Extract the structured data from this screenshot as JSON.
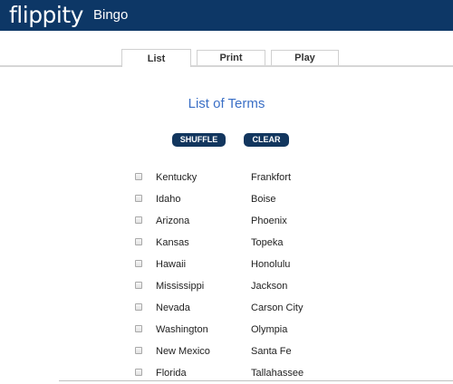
{
  "header": {
    "logo": "flippity",
    "app_title": "Bingo"
  },
  "tabs": [
    {
      "label": "List",
      "active": true
    },
    {
      "label": "Print",
      "active": false
    },
    {
      "label": "Play",
      "active": false
    }
  ],
  "main": {
    "heading": "List of Terms",
    "shuffle_label": "SHUFFLE",
    "clear_label": "CLEAR"
  },
  "terms": [
    {
      "term": "Kentucky",
      "definition": "Frankfort",
      "checked": false
    },
    {
      "term": "Idaho",
      "definition": "Boise",
      "checked": false
    },
    {
      "term": "Arizona",
      "definition": "Phoenix",
      "checked": false
    },
    {
      "term": "Kansas",
      "definition": "Topeka",
      "checked": false
    },
    {
      "term": "Hawaii",
      "definition": "Honolulu",
      "checked": false
    },
    {
      "term": "Mississippi",
      "definition": "Jackson",
      "checked": false
    },
    {
      "term": "Nevada",
      "definition": "Carson City",
      "checked": false
    },
    {
      "term": "Washington",
      "definition": "Olympia",
      "checked": false
    },
    {
      "term": "New Mexico",
      "definition": "Santa Fe",
      "checked": false
    },
    {
      "term": "Florida",
      "definition": "Tallahassee",
      "checked": false
    }
  ],
  "colors": {
    "header_bg": "#0d3766",
    "button_bg": "#12365e",
    "heading_text": "#3a6fc6"
  }
}
